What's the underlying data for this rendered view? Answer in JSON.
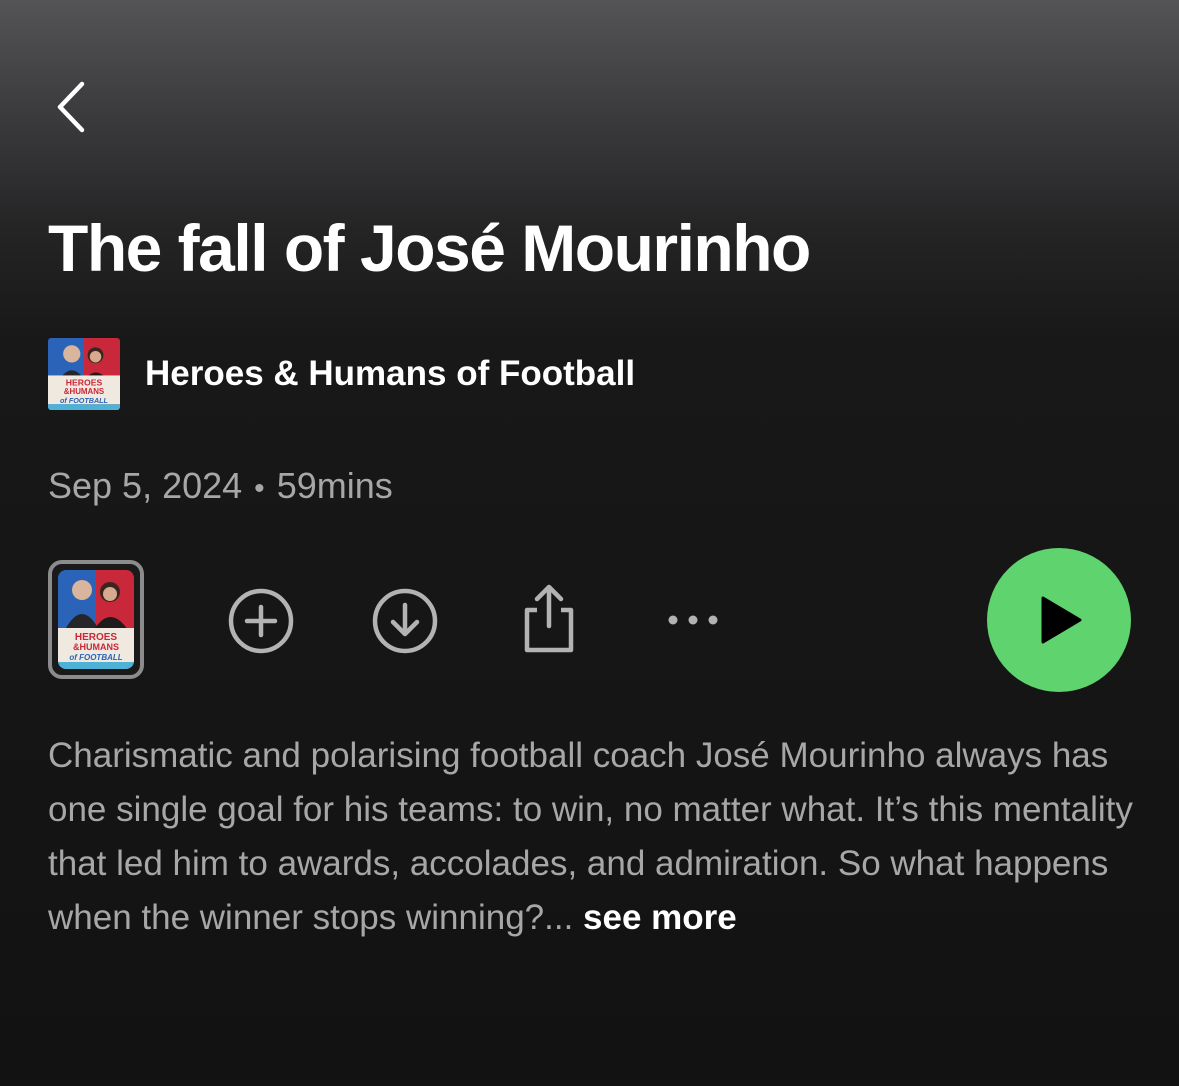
{
  "header": {
    "back_icon": "chevron-left-icon"
  },
  "episode": {
    "title": "The fall of José Mourinho",
    "show_name": "Heroes & Humans of Football",
    "date": "Sep 5, 2024",
    "separator": "•",
    "duration": "59mins",
    "description": "Charismatic and polarising football coach José Mourinho always has one single goal for his teams: to win, no matter what. It’s this mentality that led him to awards, accolades, and admiration. So what happens when the winner stops winning?...",
    "see_more_label": "see more"
  },
  "artwork": {
    "line1": "HEROES",
    "line2": "&HUMANS",
    "line3": "of FOOTBALL"
  },
  "actions": {
    "icons": [
      "add-circle-icon",
      "download-circle-icon",
      "share-icon",
      "more-dots-icon"
    ],
    "play_icon": "play-icon"
  },
  "colors": {
    "accent": "#5fd36e",
    "text_primary": "#ffffff",
    "text_secondary": "#a7a7a7"
  }
}
